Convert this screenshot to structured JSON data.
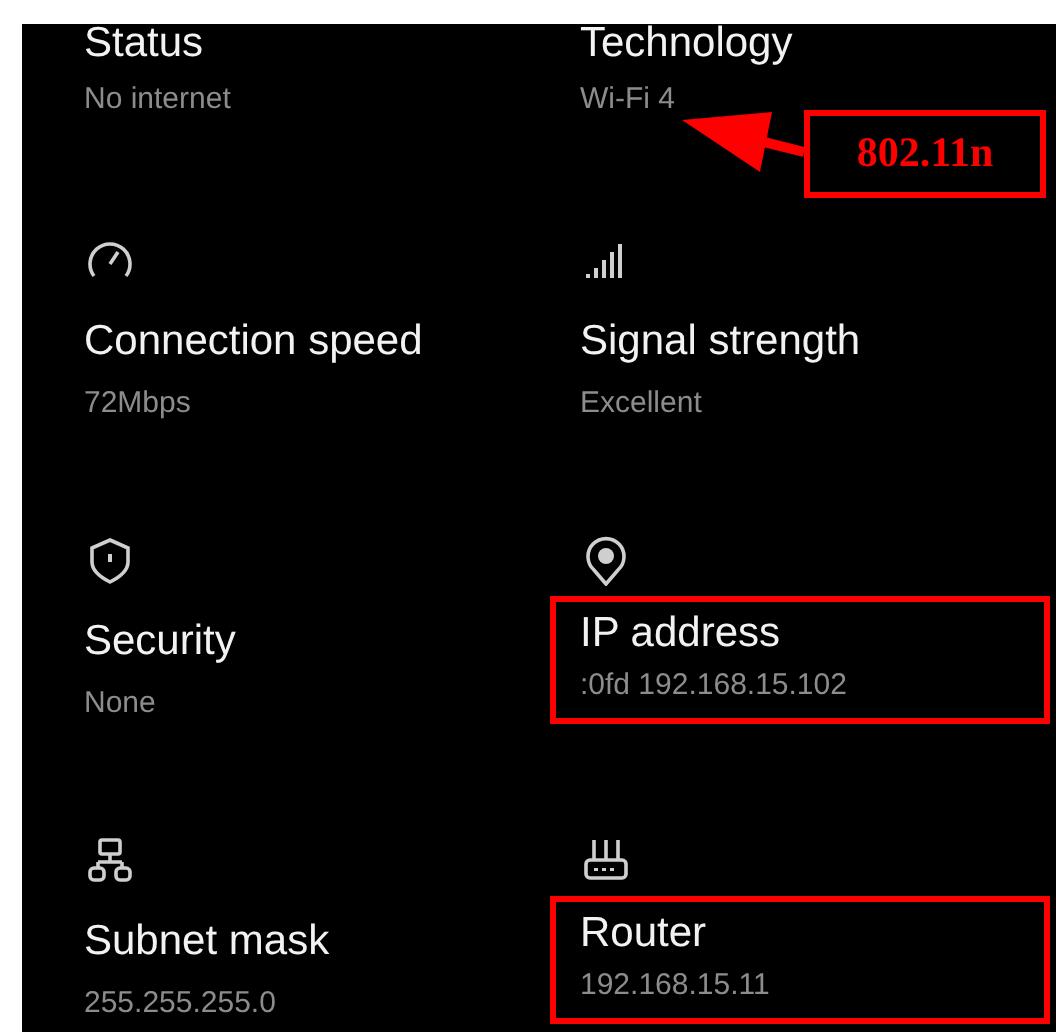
{
  "details": [
    {
      "label": "Status",
      "value": "No internet",
      "highlighted": false
    },
    {
      "label": "Technology",
      "value": "Wi-Fi 4",
      "highlighted": false
    },
    {
      "label": "Connection speed",
      "value": "72Mbps",
      "highlighted": false
    },
    {
      "label": "Signal strength",
      "value": "Excellent",
      "highlighted": false
    },
    {
      "label": "Security",
      "value": "None",
      "highlighted": false
    },
    {
      "label": "IP address",
      "value": ":0fd 192.168.15.102",
      "highlighted": true
    },
    {
      "label": "Subnet mask",
      "value": "255.255.255.0",
      "highlighted": false
    },
    {
      "label": "Router",
      "value": "192.168.15.11",
      "highlighted": true
    }
  ],
  "callout": {
    "text": "802.11n"
  }
}
